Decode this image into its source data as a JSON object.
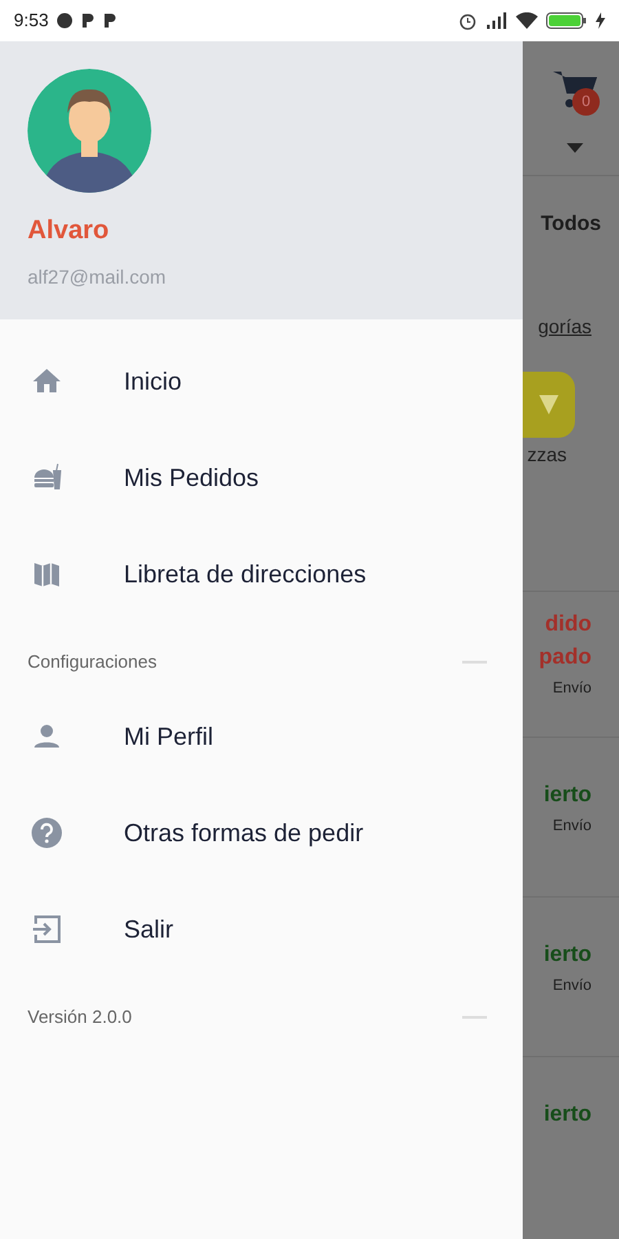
{
  "status_bar": {
    "time": "9:53"
  },
  "drawer": {
    "user": {
      "name": "Alvaro",
      "email": "alf27@mail.com"
    },
    "menu": [
      {
        "label": "Inicio",
        "kind": "home"
      },
      {
        "label": "Mis Pedidos",
        "kind": "orders"
      },
      {
        "label": "Libreta de direcciones",
        "kind": "map"
      }
    ],
    "sections": [
      {
        "title": "Configuraciones",
        "items": [
          {
            "label": "Mi Perfil",
            "kind": "profile"
          },
          {
            "label": "Otras formas de pedir",
            "kind": "help"
          },
          {
            "label": "Salir",
            "kind": "logout"
          }
        ]
      }
    ],
    "version": "Versión 2.0.0"
  },
  "background": {
    "cart_count": "0",
    "filter": "Todos",
    "link": "gorías",
    "category": "zzas",
    "stores": [
      {
        "status": [
          "dido",
          "pado"
        ],
        "color": "#a3302a",
        "delivery": "Envío"
      },
      {
        "status": [
          "ierto"
        ],
        "color": "#174d1a",
        "delivery": "Envío"
      },
      {
        "status": [
          "ierto"
        ],
        "color": "#174d1a",
        "delivery": "Envío"
      },
      {
        "status": [
          "ierto"
        ],
        "color": "#174d1a"
      }
    ]
  }
}
